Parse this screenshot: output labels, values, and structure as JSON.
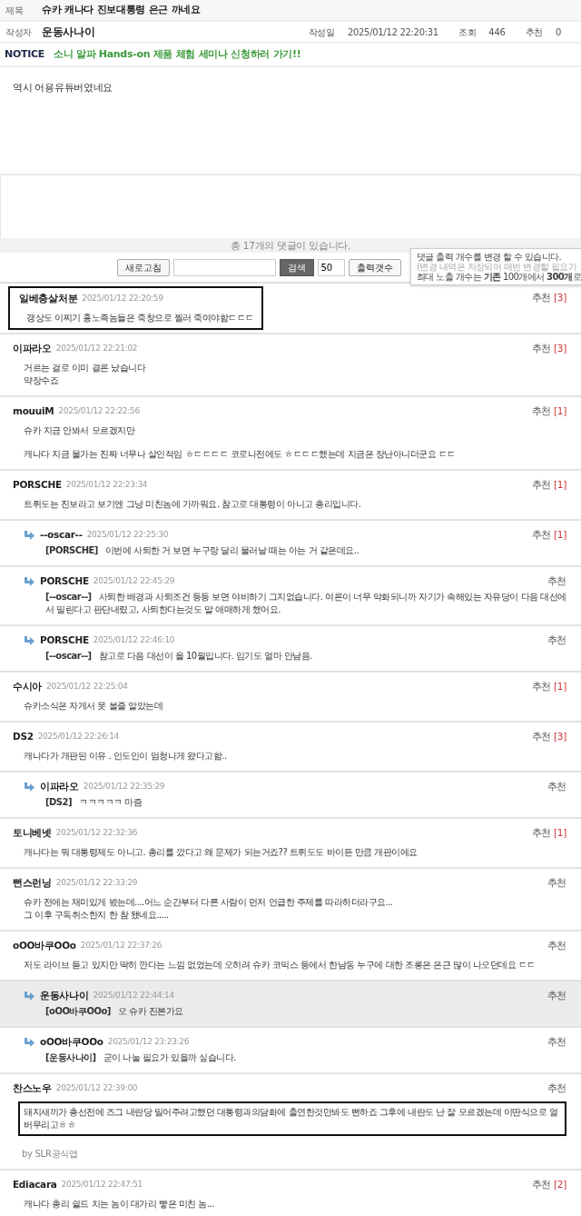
{
  "post": {
    "title_label": "제목",
    "title": "슈카 캐나다 진보대통령 은근 까네요",
    "author_label": "작성자",
    "author": "운동사나이",
    "meta": [
      {
        "label": "작성일",
        "value": "2025/01/12 22:20:31"
      },
      {
        "label": "조회",
        "value": "446"
      },
      {
        "label": "추천",
        "value": "0"
      }
    ]
  },
  "notice": {
    "label": "NOTICE",
    "text": "소니 알파 Hands-on 제품 체험 세미나 신청하러 가기!!"
  },
  "body": "역시 어용유튜버였네요",
  "comment_count": "총 17개의 댓글이 있습니다.",
  "controls": {
    "refresh": "새로고침",
    "search": "검색",
    "count_value": "50",
    "count_button": "출력갯수"
  },
  "tooltip": {
    "lines": [
      "댓글 출력 개수를 변경 할 수 있습니다.",
      "(변경 내역은 저장되어 매번 변경할 필요가",
      "최대 노출 개수는 **기존** 100개에서 **300개**로"
    ]
  },
  "comments": [
    {
      "kind": "comment",
      "author": "일베충살처분",
      "date": "2025/01/12 22:20:59",
      "recommend_label": "추천",
      "recommend_count": "[3]",
      "outlined": true,
      "outline_includes_author": true,
      "highlighted": false,
      "paragraphs": [
        [
          "갱상도 이찌기 흉노족놈들은 죽창으로 찔러 죽여야함ㄷㄷㄷ"
        ]
      ]
    },
    {
      "kind": "comment",
      "author": "이파라오",
      "date": "2025/01/12 22:21:02",
      "recommend_label": "추천",
      "recommend_count": "[3]",
      "highlighted": false,
      "paragraphs": [
        [
          "거르는 걸로 이미 결론 났습니다",
          "약장수죠"
        ]
      ]
    },
    {
      "kind": "comment",
      "author": "mouuiM",
      "date": "2025/01/12 22:22:56",
      "recommend_label": "추천",
      "recommend_count": "[1]",
      "highlighted": false,
      "paragraphs": [
        [
          "슈카 지금 안봐서 모르겠지만"
        ],
        [
          "캐나다 지금 물가는 진짜 너무나 살인적임 ㅎㄷㄷㄷㄷ 코로나전에도 ㅎㄷㄷㄷ했는데 지금은 장난아니더군요 ㄷㄷ"
        ]
      ]
    },
    {
      "kind": "comment",
      "author": "PORSCHE",
      "date": "2025/01/12 22:23:34",
      "recommend_label": "추천",
      "recommend_count": "[1]",
      "highlighted": false,
      "paragraphs": [
        [
          "트뤼도는 진보라고 보기엔 그냥 미친놈에 가까워요. 참고로 대통령이 아니고 총리입니다."
        ]
      ]
    },
    {
      "kind": "reply",
      "author": "--oscar--",
      "date": "2025/01/12 22:25:30",
      "recommend_label": "추천",
      "recommend_count": "[1]",
      "highlighted": false,
      "reply_to": "[PORSCHE]",
      "paragraphs": [
        [
          "이번에 사퇴한 거 보면 누구랑 달리 물러날 때는 아는 거 같은데요.."
        ]
      ]
    },
    {
      "kind": "reply",
      "author": "PORSCHE",
      "date": "2025/01/12 22:45:29",
      "recommend_label": "추천",
      "highlighted": false,
      "reply_to": "[--oscar--]",
      "paragraphs": [
        [
          "사퇴한 배경과 사퇴조건 등등 보면 야비하기 그지없습니다. 여론이 너무 악화되니까 자기가 속해있는 자유당이 다음 대선에서 밀린다고 판단내렸고, 사퇴한다는것도 말 애매하게 했어요."
        ]
      ]
    },
    {
      "kind": "reply",
      "author": "PORSCHE",
      "date": "2025/01/12 22:46:10",
      "recommend_label": "추천",
      "highlighted": false,
      "reply_to": "[--oscar--]",
      "paragraphs": [
        [
          "참고로 다음 대선이 올 10월입니다. 임기도 얼마 안남음."
        ]
      ]
    },
    {
      "kind": "comment",
      "author": "수시아",
      "date": "2025/01/12 22:25:04",
      "recommend_label": "추천",
      "recommend_count": "[1]",
      "highlighted": false,
      "paragraphs": [
        [
          "슈카소식은 자게서 못 볼줄 알았는데"
        ]
      ]
    },
    {
      "kind": "comment",
      "author": "DS2",
      "date": "2025/01/12 22:26:14",
      "recommend_label": "추천",
      "recommend_count": "[3]",
      "highlighted": false,
      "paragraphs": [
        [
          "캐나다가 개판된 이유 . 인도인이 엄청나게 왔다고함.."
        ]
      ]
    },
    {
      "kind": "reply",
      "author": "이파라오",
      "date": "2025/01/12 22:35:29",
      "recommend_label": "추천",
      "highlighted": false,
      "reply_to": "[DS2]",
      "paragraphs": [
        [
          "ㅋㅋㅋㅋㅋ 마즘"
        ]
      ]
    },
    {
      "kind": "comment",
      "author": "토니베넷",
      "date": "2025/01/12 22:32:36",
      "recommend_label": "추천",
      "recommend_count": "[1]",
      "highlighted": false,
      "paragraphs": [
        [
          "캐나다는 뭐 대통령제도 아니고. 총리를 깠다고 왜 문제가 되는거죠?? 트뤼도도 바이든 만큼 개판이에요"
        ]
      ]
    },
    {
      "kind": "comment",
      "author": "뻔스런닝",
      "date": "2025/01/12 22:33:29",
      "recommend_label": "추천",
      "highlighted": false,
      "paragraphs": [
        [
          "슈카 전에는 재미있게 봤는데....어느 순간부터 다른 사람이 먼저 언급한 주제를 따라하더라구요...",
          "그 이후 구독취소한지 한 참 됐네요....."
        ]
      ]
    },
    {
      "kind": "comment",
      "author": "oOO바쿠OOo",
      "date": "2025/01/12 22:37:26",
      "recommend_label": "추천",
      "highlighted": false,
      "paragraphs": [
        [
          "저도 라이브 듣고 있지만 딱히 깐다는 느낌 없었는데 오히려 슈카 코믹스 등에서 한남동 누구에 대한 조롱은 은근 많이 나오던데요 ㄷㄷ"
        ]
      ]
    },
    {
      "kind": "reply",
      "author": "운동사나이",
      "date": "2025/01/12 22:44:14",
      "recommend_label": "추천",
      "highlighted": true,
      "reply_to": "[oOO바쿠OOo]",
      "paragraphs": [
        [
          "오 슈카 진본가요"
        ]
      ]
    },
    {
      "kind": "reply",
      "author": "oOO바쿠OOo",
      "date": "2025/01/12 23:23:26",
      "recommend_label": "추천",
      "highlighted": false,
      "reply_to": "[운동사나이]",
      "paragraphs": [
        [
          "굳이 나눌 필요가 있을까 싶습니다."
        ]
      ]
    },
    {
      "kind": "comment",
      "author": "찬스노우",
      "date": "2025/01/12 22:39:00",
      "recommend_label": "추천",
      "outlined": true,
      "outline_includes_author": false,
      "highlighted": false,
      "via_prefix": "by",
      "via_app": "SLR공식앱",
      "paragraphs": [
        [
          "돼지새끼가 총선전에 즈그 내란당 밀어주려고했던 대통령과의담화에 출연한것만봐도 뻔하죠 그후에 내란도 난 잘 모르겠는데 이딴식으로 얼버무리고ㅎㅎ"
        ]
      ]
    },
    {
      "kind": "comment",
      "author": "Ediacara",
      "date": "2025/01/12 22:47:51",
      "recommend_label": "추천",
      "recommend_count": "[2]",
      "highlighted": false,
      "paragraphs": [
        [
          "캐나다 총리 쉴드 치는 놈이 대가리 빻은 미친 놈..."
        ]
      ]
    }
  ]
}
